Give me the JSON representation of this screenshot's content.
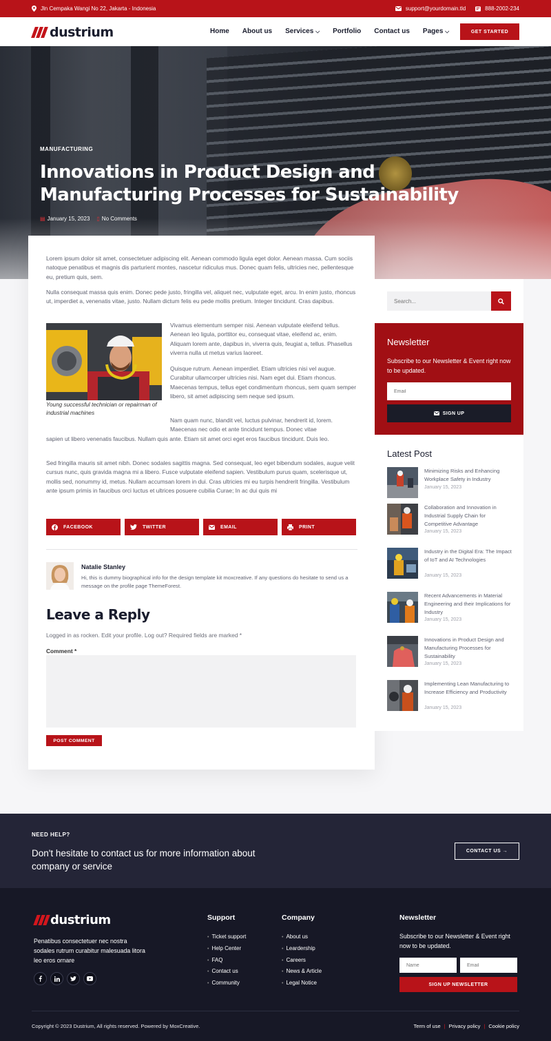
{
  "topbar": {
    "address": "Jln Cempaka Wangi No 22, Jakarta - Indonesia",
    "email": "support@yourdomain.tld",
    "phone": "888-2002-234"
  },
  "header": {
    "logo": "dustrium",
    "nav": [
      "Home",
      "About us",
      "Services",
      "Portfolio",
      "Contact us",
      "Pages"
    ],
    "cta": "GET STARTED"
  },
  "hero": {
    "category": "MANUFACTURING",
    "title": "Innovations in Product Design and Manufacturing Processes for Sustainability",
    "date": "January 15, 2023",
    "comments": "No Comments"
  },
  "article": {
    "p1": "Lorem ipsum dolor sit amet, consectetuer adipiscing elit. Aenean commodo ligula eget dolor. Aenean massa. Cum sociis natoque penatibus et magnis dis parturient montes, nascetur ridiculus mus. Donec quam felis, ultricies nec, pellentesque eu, pretium quis, sem.",
    "p2": "Nulla consequat massa quis enim. Donec pede justo, fringilla vel, aliquet nec, vulputate eget, arcu. In enim justo, rhoncus ut, imperdiet a, venenatis vitae, justo. Nullam dictum felis eu pede mollis pretium. Integer tincidunt. Cras dapibus.",
    "p3": "Vivamus elementum semper nisi. Aenean vulputate eleifend tellus. Aenean leo ligula, porttitor eu, consequat vitae, eleifend ac, enim. Aliquam lorem ante, dapibus in, viverra quis, feugiat a, tellus. Phasellus viverra nulla ut metus varius laoreet.",
    "p4": "Quisque rutrum. Aenean imperdiet. Etiam ultricies nisi vel augue. Curabitur ullamcorper ultricies nisi. Nam eget dui. Etiam rhoncus. Maecenas tempus, tellus eget condimentum rhoncus, sem quam semper libero, sit amet adipiscing sem neque sed ipsum.",
    "p5a": "Nam quam nunc, blandit vel, luctus pulvinar, hendrerit id, lorem. Maecenas nec odio et ante tincidunt tempus. Donec vitae",
    "p5b": "sapien ut libero venenatis faucibus. Nullam quis ante. Etiam sit amet orci eget eros faucibus tincidunt. Duis leo.",
    "p6": "Sed fringilla mauris sit amet nibh. Donec sodales sagittis magna. Sed consequat, leo eget bibendum sodales, augue velit cursus nunc, quis gravida magna mi a libero. Fusce vulputate eleifend sapien. Vestibulum purus quam, scelerisque ut, mollis sed, nonummy id, metus. Nullam accumsan lorem in dui. Cras ultricies mi eu turpis hendrerit fringilla. Vestibulum ante ipsum primis in faucibus orci luctus et ultrices posuere cubilia Curae; In ac dui quis mi",
    "caption": "Young successful technician or repairman of industrial machines",
    "share": [
      "FACEBOOK",
      "TWITTER",
      "EMAIL",
      "PRINT"
    ]
  },
  "author": {
    "name": "Natalie Stanley",
    "bio": "Hi, this is dummy biographical info for the design template kit moxcreative. If any questions do hesitate to send us a message on the profile page ThemeForest."
  },
  "reply": {
    "title": "Leave a Reply",
    "note": "Logged in as rocken. Edit your profile. Log out? Required fields are marked *",
    "comment_label": "Comment *",
    "submit": "POST COMMENT"
  },
  "sidebar": {
    "search_placeholder": "Search...",
    "newsletter": {
      "title": "Newsletter",
      "text": "Subscribe to our Newsletter & Event right now to be updated.",
      "email_placeholder": "Email",
      "button": "SIGN UP"
    },
    "latest": {
      "title": "Latest Post",
      "posts": [
        {
          "title": "Minimizing Risks and Enhancing Workplace Safety in Industry",
          "date": "January 15, 2023"
        },
        {
          "title": "Collaboration and Innovation in Industrial Supply Chain for Competitive Advantage",
          "date": "January 15, 2023"
        },
        {
          "title": "Industry in the Digital Era: The Impact of IoT and AI Technologies",
          "date": "January 15, 2023"
        },
        {
          "title": "Recent Advancements in Material Engineering and their Implications for Industry",
          "date": "January 15, 2023"
        },
        {
          "title": "Innovations in Product Design and Manufacturing Processes for Sustainability",
          "date": "January 15, 2023"
        },
        {
          "title": "Implementing Lean Manufacturing to Increase Efficiency and Productivity",
          "date": "January 15, 2023"
        }
      ]
    }
  },
  "cta": {
    "label": "NEED HELP?",
    "text": "Don't hesitate to contact us for more information about company or service",
    "button": "CONTACT US"
  },
  "footer": {
    "logo": "dustrium",
    "description": "Penatibus consectetuer nec nostra sodales rutrum curabitur malesuada litora leo eros ornare",
    "support_title": "Support",
    "support_links": [
      "Ticket support",
      "Help Center",
      "FAQ",
      "Contact us",
      "Community"
    ],
    "company_title": "Company",
    "company_links": [
      "About us",
      "Leardership",
      "Careers",
      "News & Article",
      "Legal Notice"
    ],
    "newsletter_title": "Newsletter",
    "newsletter_text": "Subscribe to our Newsletter & Event right now to be updated.",
    "name_placeholder": "Name",
    "email_placeholder": "Email",
    "newsletter_button": "SIGN UP NEWSLETTER",
    "copyright": "Copyright © 2023 Dustrium, All rights reserved. Powered by MoxCreative.",
    "legal_links": [
      "Term of use",
      "Privacy policy",
      "Cookie policy"
    ]
  },
  "colors": {
    "accent": "#b81319",
    "dark": "#242537",
    "footer": "#171826"
  }
}
